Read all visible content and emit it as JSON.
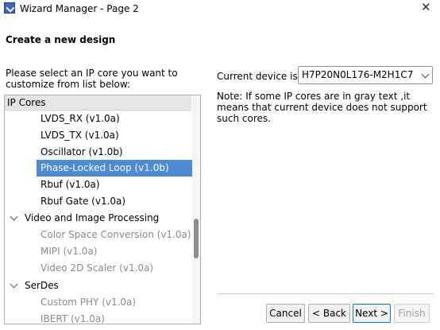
{
  "window": {
    "title": "Wizard Manager - Page 2",
    "close_glyph": "✕"
  },
  "page": {
    "heading": "Create a new design",
    "instructions": "Please select an IP core you want to customize from list below:"
  },
  "tree": {
    "header": "IP Cores",
    "items": [
      {
        "label": "LVDS_RX (v1.0a)",
        "state": "normal"
      },
      {
        "label": "LVDS_TX (v1.0a)",
        "state": "normal"
      },
      {
        "label": "Oscillator (v1.0b)",
        "state": "normal"
      },
      {
        "label": "Phase-Locked Loop (v1.0b)",
        "state": "selected"
      },
      {
        "label": "Rbuf (v1.0a)",
        "state": "normal"
      },
      {
        "label": "Rbuf Gate (v1.0a)",
        "state": "normal"
      }
    ],
    "category_video": "Video and Image Processing",
    "video_items": [
      {
        "label": "Color Space Conversion (v1.0a)",
        "state": "disabled"
      },
      {
        "label": "MIPI (v1.0a)",
        "state": "disabled"
      },
      {
        "label": "Video 2D Scaler (v1.0a)",
        "state": "disabled"
      }
    ],
    "category_serdes": "SerDes",
    "serdes_items": [
      {
        "label": "Custom PHY (v1.0a)",
        "state": "disabled"
      },
      {
        "label": "IBERT (v1.0a)",
        "state": "disabled"
      }
    ]
  },
  "device": {
    "label": "Current device is:",
    "value": "H7P20N0L176-M2H1C7"
  },
  "note": "Note: If some IP cores are in gray text ,it means that current device does not support such cores.",
  "buttons": {
    "cancel": "Cancel",
    "back": "< Back",
    "next": "Next >",
    "finish": "Finish"
  },
  "colors": {
    "selection": "#4a8ad6",
    "disabled_text": "#8a8a8a",
    "header_bg": "#e4e4e4"
  }
}
